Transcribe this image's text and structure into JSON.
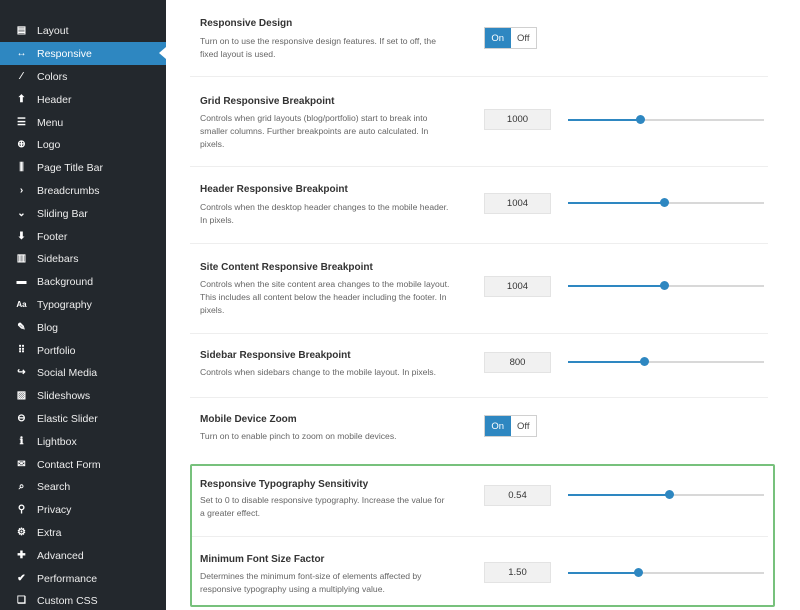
{
  "sidebar": {
    "items": [
      {
        "label": "Layout",
        "icon": "layout-icon",
        "glyph": "▤"
      },
      {
        "label": "Responsive",
        "icon": "arrows-horizontal-icon",
        "glyph": "↔",
        "active": true
      },
      {
        "label": "Colors",
        "icon": "pencil-icon",
        "glyph": "∕"
      },
      {
        "label": "Header",
        "icon": "arrow-up-icon",
        "glyph": "⬆"
      },
      {
        "label": "Menu",
        "icon": "menu-icon",
        "glyph": "☰"
      },
      {
        "label": "Logo",
        "icon": "plus-circle-icon",
        "glyph": "⊕"
      },
      {
        "label": "Page Title Bar",
        "icon": "sliders-icon",
        "glyph": "⫼"
      },
      {
        "label": "Breadcrumbs",
        "icon": "chevron-right-icon",
        "glyph": "›"
      },
      {
        "label": "Sliding Bar",
        "icon": "chevron-down-icon",
        "glyph": "⌄"
      },
      {
        "label": "Footer",
        "icon": "arrow-down-icon",
        "glyph": "⬇"
      },
      {
        "label": "Sidebars",
        "icon": "sidebars-icon",
        "glyph": "▥"
      },
      {
        "label": "Background",
        "icon": "background-icon",
        "glyph": "▬"
      },
      {
        "label": "Typography",
        "icon": "typography-icon",
        "glyph": "Aa"
      },
      {
        "label": "Blog",
        "icon": "edit-icon",
        "glyph": "✎"
      },
      {
        "label": "Portfolio",
        "icon": "grid-icon",
        "glyph": "⠿"
      },
      {
        "label": "Social Media",
        "icon": "share-icon",
        "glyph": "↪"
      },
      {
        "label": "Slideshows",
        "icon": "image-icon",
        "glyph": "▨"
      },
      {
        "label": "Elastic Slider",
        "icon": "elastic-slider-icon",
        "glyph": "⊖"
      },
      {
        "label": "Lightbox",
        "icon": "info-icon",
        "glyph": "ℹ"
      },
      {
        "label": "Contact Form",
        "icon": "envelope-icon",
        "glyph": "✉"
      },
      {
        "label": "Search",
        "icon": "search-icon",
        "glyph": "⌕"
      },
      {
        "label": "Privacy",
        "icon": "user-icon",
        "glyph": "⚲"
      },
      {
        "label": "Extra",
        "icon": "cogs-icon",
        "glyph": "⚙"
      },
      {
        "label": "Advanced",
        "icon": "puzzle-icon",
        "glyph": "✚"
      },
      {
        "label": "Performance",
        "icon": "check-circle-icon",
        "glyph": "✔"
      },
      {
        "label": "Custom CSS",
        "icon": "css3-icon",
        "glyph": "❏"
      }
    ]
  },
  "settings": {
    "responsive_design": {
      "title": "Responsive Design",
      "description": "Turn on to use the responsive design features. If set to off, the fixed layout is used.",
      "on_label": "On",
      "off_label": "Off",
      "value": "On"
    },
    "grid_breakpoint": {
      "title": "Grid Responsive Breakpoint",
      "description": "Controls when grid layouts (blog/portfolio) start to break into smaller columns. Further breakpoints are auto calculated. In pixels.",
      "value": "1000",
      "slider_fraction": 0.37
    },
    "header_breakpoint": {
      "title": "Header Responsive Breakpoint",
      "description": "Controls when the desktop header changes to the mobile header. In pixels.",
      "value": "1004",
      "slider_fraction": 0.49
    },
    "site_content_breakpoint": {
      "title": "Site Content Responsive Breakpoint",
      "description": "Controls when the site content area changes to the mobile layout. This includes all content below the header including the footer. In pixels.",
      "value": "1004",
      "slider_fraction": 0.49
    },
    "sidebar_breakpoint": {
      "title": "Sidebar Responsive Breakpoint",
      "description": "Controls when sidebars change to the mobile layout. In pixels.",
      "value": "800",
      "slider_fraction": 0.39
    },
    "mobile_zoom": {
      "title": "Mobile Device Zoom",
      "description": "Turn on to enable pinch to zoom on mobile devices.",
      "on_label": "On",
      "off_label": "Off",
      "value": "On"
    },
    "typography_sensitivity": {
      "title": "Responsive Typography Sensitivity",
      "description": "Set to 0 to disable responsive typography. Increase the value for a greater effect.",
      "value": "0.54",
      "slider_fraction": 0.52
    },
    "min_font_size_factor": {
      "title": "Minimum Font Size Factor",
      "description": "Determines the minimum font-size of elements affected by responsive typography using a multiplying value.",
      "value": "1.50",
      "slider_fraction": 0.36
    }
  },
  "colors": {
    "accent": "#2e87c1",
    "sidebar_bg": "#23282d",
    "highlight_border": "#77c17c"
  }
}
